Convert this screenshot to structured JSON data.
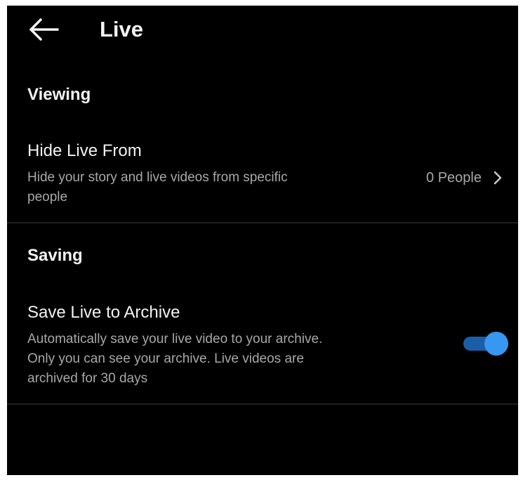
{
  "header": {
    "title": "Live",
    "back_icon": "arrow-left-icon"
  },
  "sections": {
    "viewing": {
      "title": "Viewing",
      "hide_live": {
        "title": "Hide Live From",
        "description_line1": "Hide your story and live videos from specific",
        "description_line2": "people",
        "value": "0 People",
        "chevron_icon": "chevron-right-icon"
      }
    },
    "saving": {
      "title": "Saving",
      "save_archive": {
        "title": "Save Live to Archive",
        "description_line1": "Automatically save your live video to your archive.",
        "description_line2": "Only you can see your archive. Live videos are",
        "description_line3": "archived for 30 days",
        "toggle_on": true
      }
    }
  },
  "colors": {
    "background": "#000000",
    "text_primary": "#f2f2f2",
    "text_secondary": "#a8a8a8",
    "toggle_thumb": "#3897f0",
    "toggle_track": "#1b5ea8",
    "divider": "#1f1f1f"
  }
}
